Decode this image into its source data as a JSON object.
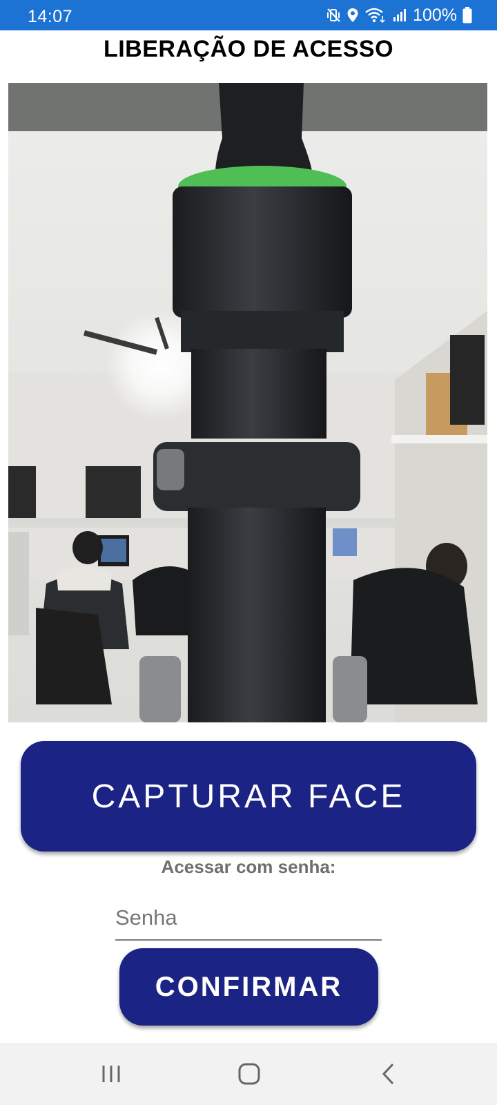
{
  "status_bar": {
    "time": "14:07",
    "battery": "100%",
    "icons": [
      "mute-vibrate-icon",
      "location-icon",
      "wifi-icon",
      "signal-icon",
      "battery-icon"
    ],
    "background": "#1d73d4"
  },
  "screen": {
    "title": "LIBERAÇÃO DE ACESSO"
  },
  "camera": {
    "content": "camera-preview"
  },
  "actions": {
    "capture_label": "CAPTURAR FACE",
    "password_prompt": "Acessar com senha:",
    "password_value": "",
    "password_placeholder": "Senha",
    "confirm_label": "CONFIRMAR",
    "button_color": "#1b2384"
  },
  "nav_bar": {
    "icons": [
      "recent-apps-icon",
      "home-icon",
      "back-icon"
    ]
  }
}
